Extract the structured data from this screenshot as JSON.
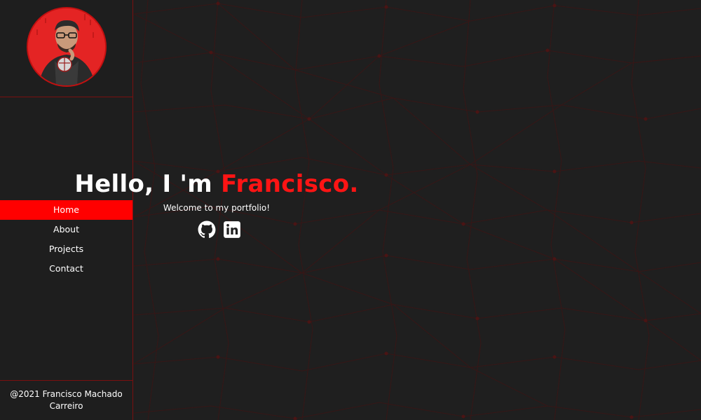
{
  "sidebar": {
    "avatar_alt": "Francisco profile photo",
    "nav": [
      {
        "label": "Home",
        "active": true
      },
      {
        "label": "About",
        "active": false
      },
      {
        "label": "Projects",
        "active": false
      },
      {
        "label": "Contact",
        "active": false
      }
    ],
    "footer": "@2021 Francisco Machado Carreiro"
  },
  "hero": {
    "greeting": "Hello, I 'm ",
    "name": "Francisco.",
    "subtitle": "Welcome to my portfolio!"
  },
  "socials": [
    {
      "icon": "github-icon"
    },
    {
      "icon": "linkedin-icon"
    }
  ],
  "colors": {
    "accent": "#ff1414",
    "background": "#1f1f1f",
    "border": "#7a1010"
  }
}
